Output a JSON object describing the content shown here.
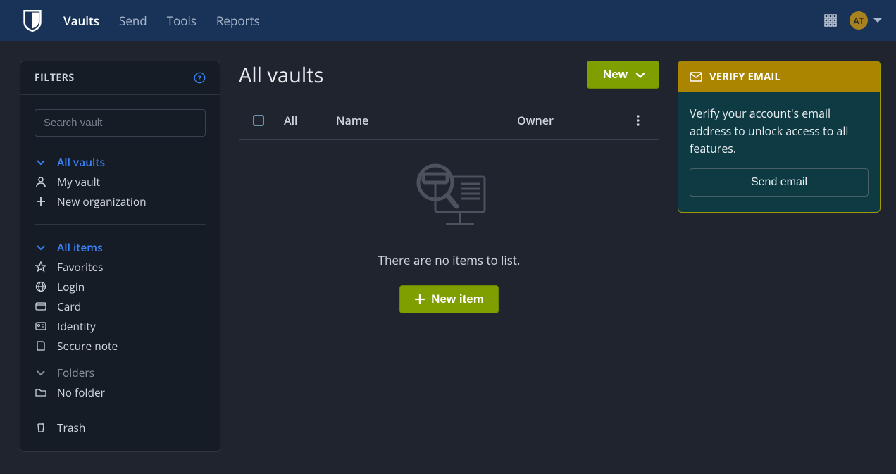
{
  "header": {
    "nav": [
      "Vaults",
      "Send",
      "Tools",
      "Reports"
    ],
    "active_nav_index": 0,
    "avatar_initials": "AT"
  },
  "sidebar": {
    "title": "FILTERS",
    "search_placeholder": "Search vault",
    "vaults": {
      "header": "All vaults",
      "items": [
        {
          "label": "My vault"
        },
        {
          "label": "New organization"
        }
      ]
    },
    "items": {
      "header": "All items",
      "list": [
        {
          "label": "Favorites"
        },
        {
          "label": "Login"
        },
        {
          "label": "Card"
        },
        {
          "label": "Identity"
        },
        {
          "label": "Secure note"
        }
      ]
    },
    "folders": {
      "header": "Folders",
      "list": [
        {
          "label": "No folder"
        }
      ]
    },
    "trash_label": "Trash"
  },
  "main": {
    "title": "All vaults",
    "new_button": "New",
    "columns": {
      "all": "All",
      "name": "Name",
      "owner": "Owner"
    },
    "empty_text": "There are no items to list.",
    "new_item_button": "New item"
  },
  "verify": {
    "title": "VERIFY EMAIL",
    "body": "Verify your account's email address to unlock access to all features.",
    "button": "Send email"
  }
}
